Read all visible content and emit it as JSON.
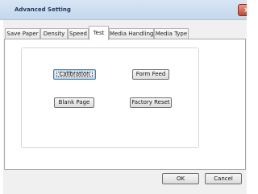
{
  "window": {
    "title": "Advanced Setting",
    "close_symbol": "×"
  },
  "tabs": [
    {
      "label": "Save Paper"
    },
    {
      "label": "Density"
    },
    {
      "label": "Speed"
    },
    {
      "label": "Test"
    },
    {
      "label": "Media Handling"
    },
    {
      "label": "Media Type"
    }
  ],
  "active_tab": "Test",
  "test_panel": {
    "calibration_label": "Calibration",
    "form_feed_label": "Form Feed",
    "blank_page_label": "Blank Page",
    "factory_reset_label": "Factory Reset"
  },
  "footer": {
    "ok_label": "OK",
    "cancel_label": "Cancel"
  },
  "colors": {
    "titlebar": "#c3d7ec",
    "dialog_background": "#f0f0f0",
    "close_button": "#c14a33",
    "default_button_border": "#3c7fb1"
  },
  "icons": {
    "close": "close-icon"
  }
}
